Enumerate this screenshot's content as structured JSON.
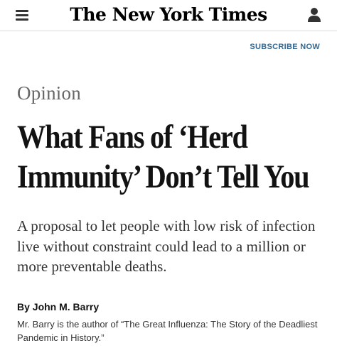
{
  "header": {
    "masthead": "The New York Times",
    "subscribe_label": "SUBSCRIBE NOW",
    "menu_icon": "hamburger-menu-icon",
    "account_icon": "user-account-icon"
  },
  "article": {
    "section": "Opinion",
    "headline": "What Fans of ‘Herd Immunity’ Don’t Tell You",
    "summary": "A proposal to let people with low risk of infection live without constraint could lead to a million or more preventable deaths.",
    "byline": "By John M. Barry",
    "bio": "Mr. Barry is the author of “The Great Influenza: The Story of the Deadliest Pandemic in History.”"
  },
  "colors": {
    "link_blue": "#326891",
    "text_dark": "#121212",
    "section_gray": "#666666"
  }
}
